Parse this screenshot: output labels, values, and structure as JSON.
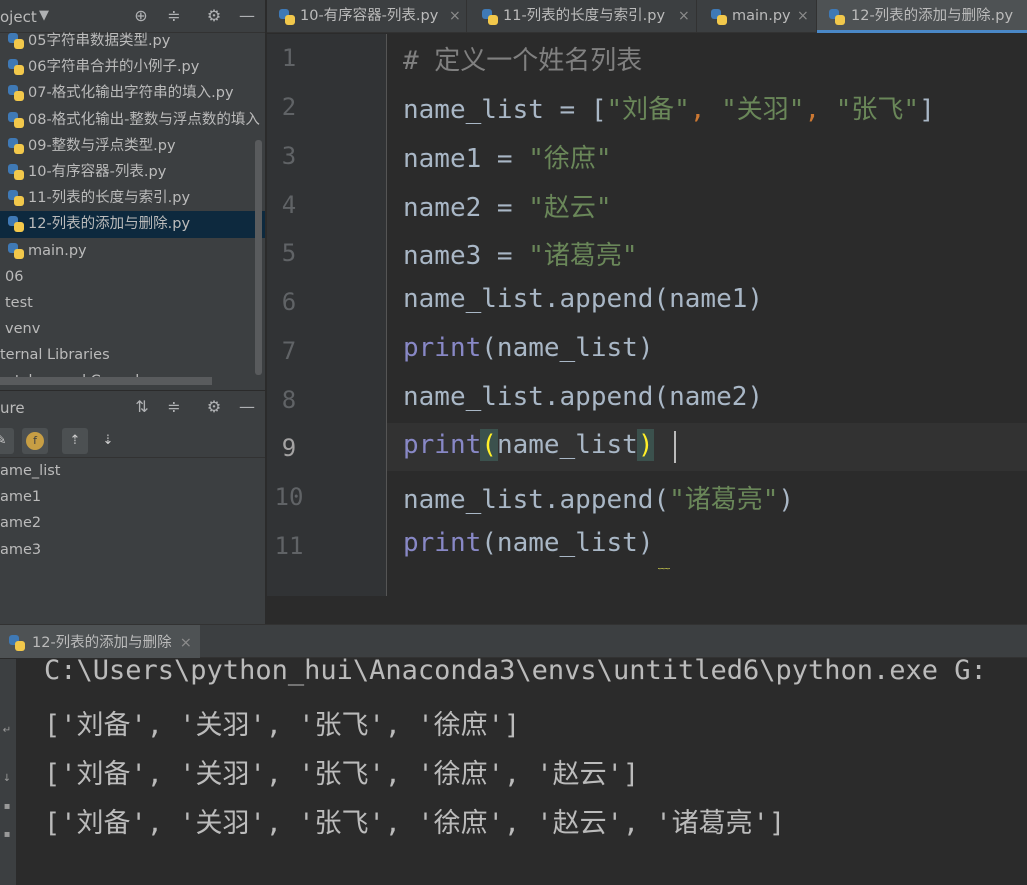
{
  "project_panel": {
    "title": "oject",
    "files": [
      {
        "label": "05字符串数据类型.py",
        "type": "py"
      },
      {
        "label": "06字符串合并的小例子.py",
        "type": "py"
      },
      {
        "label": "07-格式化输出字符串的填入.py",
        "type": "py"
      },
      {
        "label": "08-格式化输出-整数与浮点数的填入",
        "type": "py"
      },
      {
        "label": "09-整数与浮点类型.py",
        "type": "py"
      },
      {
        "label": "10-有序容器-列表.py",
        "type": "py"
      },
      {
        "label": "11-列表的长度与索引.py",
        "type": "py"
      },
      {
        "label": "12-列表的添加与删除.py",
        "type": "py",
        "selected": true
      },
      {
        "label": "main.py",
        "type": "py"
      },
      {
        "label": "06",
        "type": "folder"
      },
      {
        "label": "test",
        "type": "folder"
      },
      {
        "label": "venv",
        "type": "folder"
      },
      {
        "label": "ternal Libraries",
        "type": "lib"
      },
      {
        "label": "ratches and Consoles",
        "type": "lib"
      }
    ]
  },
  "structure_panel": {
    "title": "ure",
    "items": [
      "ame_list",
      "ame1",
      "ame2",
      "ame3"
    ]
  },
  "tabs": [
    {
      "label": "10-有序容器-列表.py",
      "close": "×"
    },
    {
      "label": "11-列表的长度与索引.py",
      "close": "×"
    },
    {
      "label": "main.py",
      "close": "×"
    },
    {
      "label": "12-列表的添加与删除.py",
      "close": "",
      "active": true
    }
  ],
  "editor": {
    "current_line": 9,
    "lines": [
      {
        "no": "1",
        "code": "# 定义一个姓名列表"
      },
      {
        "no": "2",
        "code": "name_list = [\"刘备\", \"关羽\", \"张飞\"]"
      },
      {
        "no": "3",
        "code": "name1 = \"徐庶\""
      },
      {
        "no": "4",
        "code": "name2 = \"赵云\""
      },
      {
        "no": "5",
        "code": "name3 = \"诸葛亮\""
      },
      {
        "no": "6",
        "code": "name_list.append(name1)"
      },
      {
        "no": "7",
        "code": "print(name_list)"
      },
      {
        "no": "8",
        "code": "name_list.append(name2)"
      },
      {
        "no": "9",
        "code": "print(name_list)"
      },
      {
        "no": "10",
        "code": "name_list.append(\"诸葛亮\")"
      },
      {
        "no": "11",
        "code": "print(name_list)"
      }
    ]
  },
  "run_panel": {
    "tab_label": "12-列表的添加与删除",
    "tab_close": "×",
    "output": [
      "C:\\Users\\python_hui\\Anaconda3\\envs\\untitled6\\python.exe G:",
      "['刘备', '关羽', '张飞', '徐庶']",
      "['刘备', '关羽', '张飞', '徐庶', '赵云']",
      "['刘备', '关羽', '张飞', '徐庶', '赵云', '诸葛亮']"
    ]
  },
  "colors": {
    "background": "#2b2b2b",
    "panel": "#3c3f41",
    "selection": "#0d293e",
    "string": "#6a8759",
    "keyword": "#8888c6",
    "punctuation": "#cc7832",
    "comment": "#808080",
    "tab_underline": "#4a88c7"
  },
  "icons": {
    "project_dropdown": "chevron-down-icon",
    "locate": "crosshair-icon",
    "collapse": "collapse-icon",
    "settings": "gear-icon",
    "hide": "minus-icon",
    "file": "python-file-icon"
  }
}
